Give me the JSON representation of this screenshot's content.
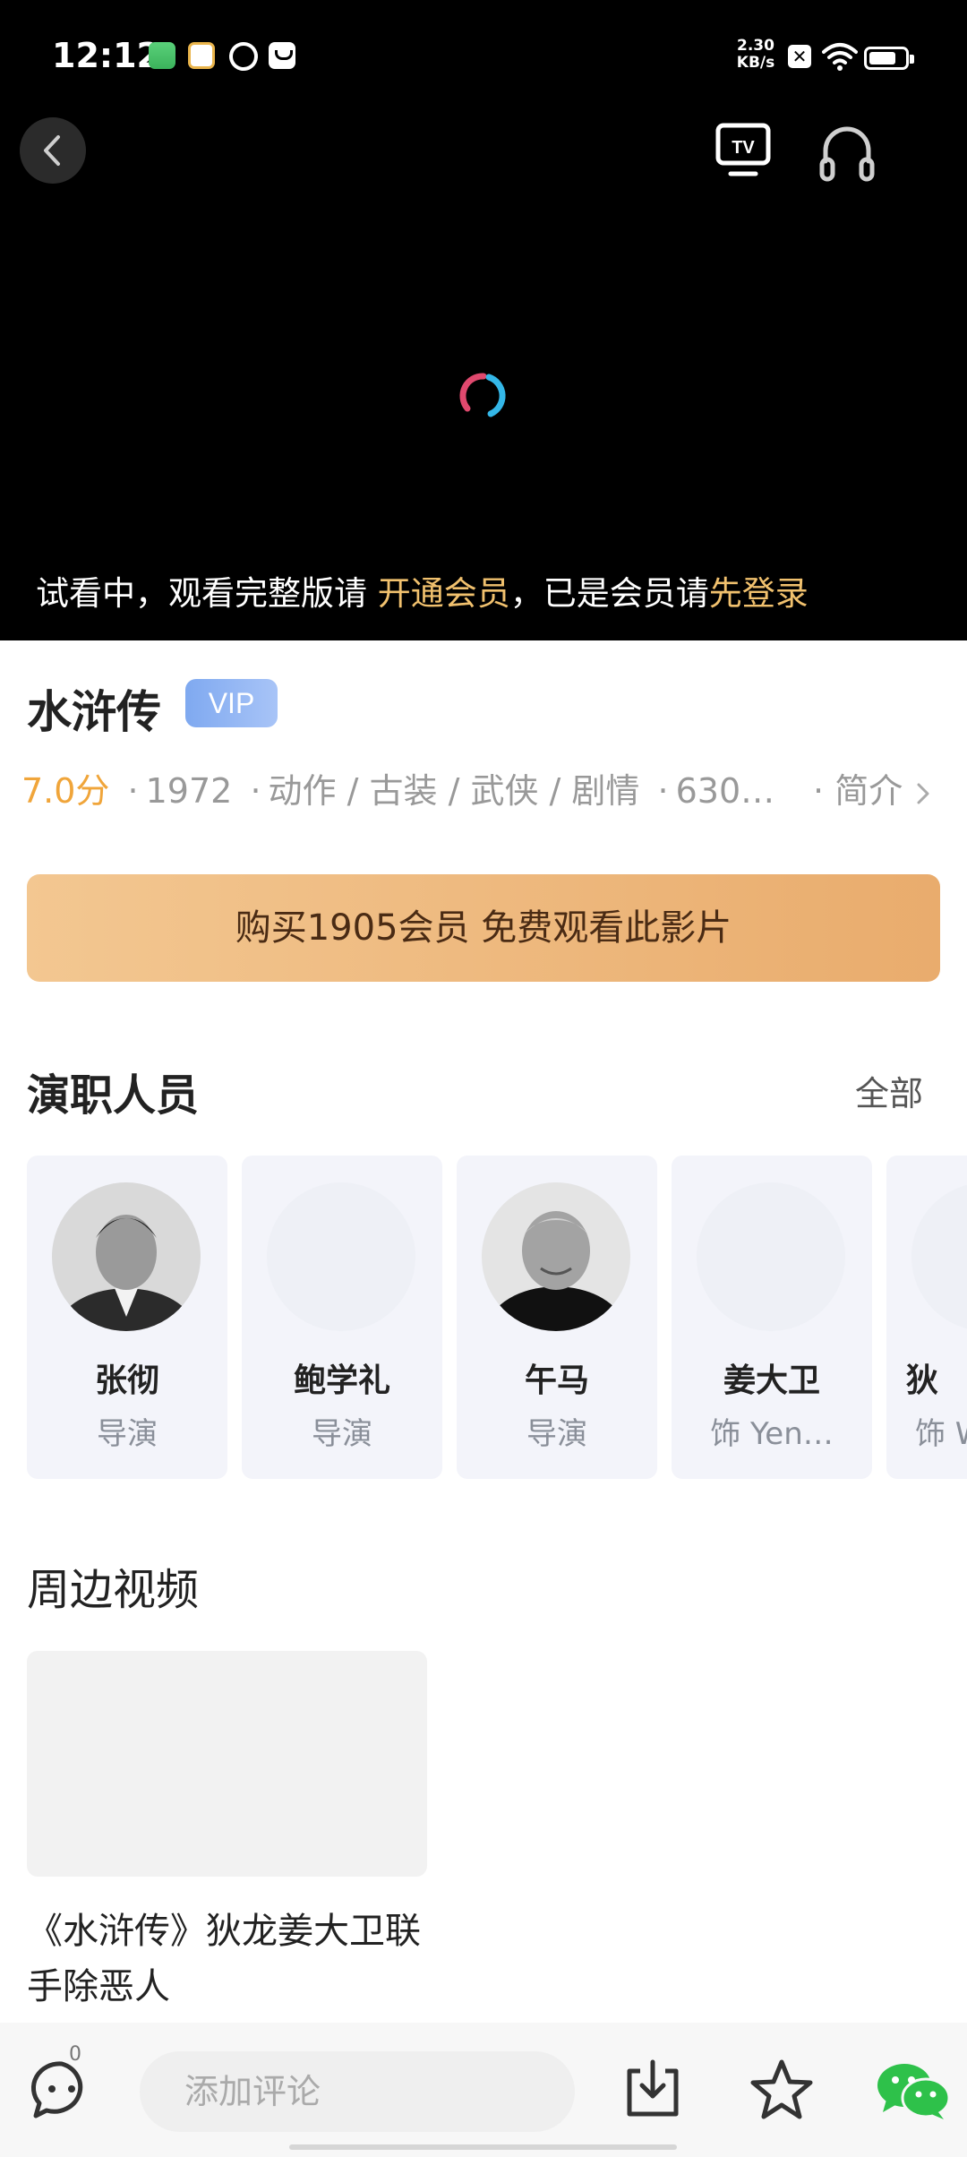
{
  "status_bar": {
    "time": "12:12",
    "net_speed_value": "2.30",
    "net_speed_unit": "KB/s",
    "sim_icon": "x-sim-icon",
    "battery_level": 0.75
  },
  "player": {
    "trial_text_1": "试看中，观看完整版请",
    "trial_link_member": "开通会员",
    "trial_text_2": "，已是会员请",
    "trial_link_login": "先登录",
    "tv_icon_label": "TV"
  },
  "movie": {
    "title": "水浒传",
    "badge": "VIP",
    "score": "7.0分",
    "dot": "·",
    "year": "1972",
    "genres": "动作 / 古装 / 武侠 / 剧情",
    "extra": "630…",
    "intro_link": "简介",
    "buy_button": "购买1905会员 免费观看此影片"
  },
  "cast": {
    "title": "演职人员",
    "all_link": "全部",
    "members": [
      {
        "name": "张彻",
        "role": "导演"
      },
      {
        "name": "鲍学礼",
        "role": "导演"
      },
      {
        "name": "午马",
        "role": "导演"
      },
      {
        "name": "姜大卫",
        "role": "饰 Yen…"
      },
      {
        "name": "狄",
        "role": "饰 W"
      }
    ]
  },
  "related": {
    "title": "周边视频",
    "videos": [
      {
        "title": "《水浒传》狄龙姜大卫联手除恶人"
      }
    ]
  },
  "bottom_bar": {
    "comment_count": "0",
    "comment_placeholder": "添加评论"
  },
  "colors": {
    "accent_gold": "#f1c16e",
    "score_orange": "#f0a53a",
    "vip_blue": "#7fa9f0",
    "buy_gradient_start": "#f3c791",
    "buy_gradient_end": "#e9ac6d",
    "wechat_green": "#2ec14a"
  }
}
